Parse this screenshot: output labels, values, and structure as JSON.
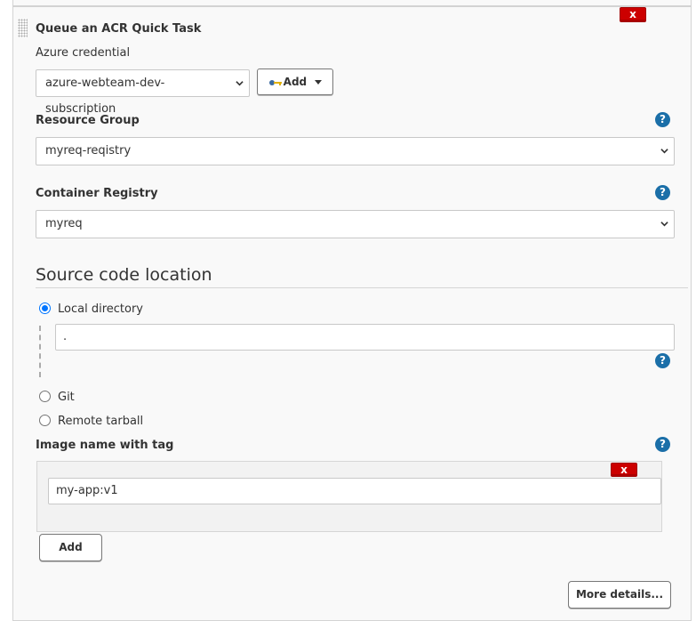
{
  "step": {
    "title": "Queue an ACR Quick Task",
    "delete_label": "x"
  },
  "azure_credential": {
    "label": "Azure credential",
    "value": "azure-webteam-dev-subscription",
    "add_label": "Add"
  },
  "resource_group": {
    "label": "Resource Group",
    "value": "myreq-reqistry",
    "help": "?"
  },
  "container_registry": {
    "label": "Container Registry",
    "value": "myreq",
    "help": "?"
  },
  "source": {
    "title": "Source code location",
    "options": [
      {
        "label": "Local directory",
        "selected": true
      },
      {
        "label": "Git",
        "selected": false
      },
      {
        "label": "Remote tarball",
        "selected": false
      }
    ],
    "local_directory_value": ".",
    "help": "?"
  },
  "image": {
    "label": "Image name with tag",
    "help": "?",
    "value": "my-app:v1",
    "delete_label": "x",
    "add_label": "Add"
  },
  "more_details_label": "More details...",
  "colors": {
    "delete": "#cc0000",
    "help": "#1b6fa8",
    "radio": "#0075ff"
  }
}
